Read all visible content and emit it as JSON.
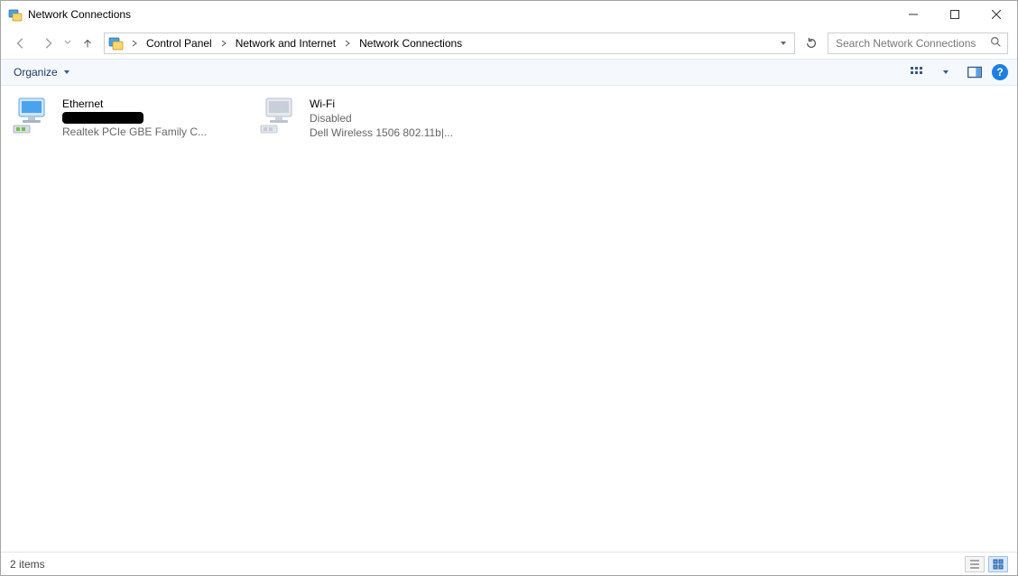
{
  "window": {
    "title": "Network Connections"
  },
  "breadcrumb": {
    "items": [
      {
        "label": "Control Panel"
      },
      {
        "label": "Network and Internet"
      },
      {
        "label": "Network Connections"
      }
    ]
  },
  "search": {
    "placeholder": "Search Network Connections"
  },
  "toolbar": {
    "organize_label": "Organize",
    "help_label": "?"
  },
  "adapters": [
    {
      "name": "Ethernet",
      "status_redacted": true,
      "hardware": "Realtek PCIe GBE Family C...",
      "disabled": false
    },
    {
      "name": "Wi-Fi",
      "status": "Disabled",
      "hardware": "Dell Wireless 1506 802.11b|...",
      "disabled": true
    }
  ],
  "statusbar": {
    "text": "2 items"
  }
}
